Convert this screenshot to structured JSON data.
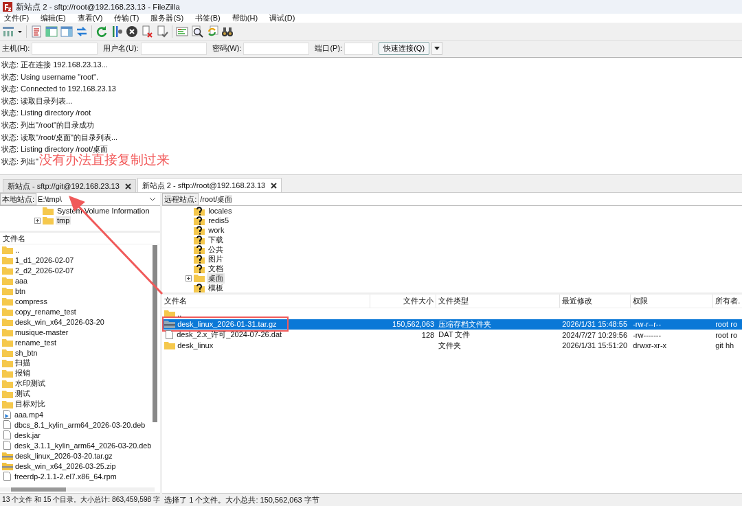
{
  "window": {
    "title": "新站点 2 - sftp://root@192.168.23.13 - FileZilla"
  },
  "menu": [
    "文件(F)",
    "编辑(E)",
    "查看(V)",
    "传输(T)",
    "服务器(S)",
    "书签(B)",
    "帮助(H)",
    "调试(D)"
  ],
  "quickconnect": {
    "fields": [
      {
        "label": "主机(H):"
      },
      {
        "label": "用户名(U):"
      },
      {
        "label": "密码(W):"
      },
      {
        "label": "端口(P):",
        "kind": "short"
      }
    ],
    "button": "快速连接(Q)"
  },
  "log": [
    "状态: 正在连接 192.168.23.13...",
    "状态: Using username \"root\".",
    "状态: Connected to 192.168.23.13",
    "状态: 读取目录列表...",
    "状态: Listing directory /root",
    "状态: 列出\"/root\"的目录成功",
    "状态: 读取\"/root/桌面\"的目录列表...",
    "状态: Listing directory /root/桌面",
    "状态: 列出\""
  ],
  "tabs": [
    {
      "label": "新站点 - sftp://git@192.168.23.13",
      "selected": false
    },
    {
      "label": "新站点 2 - sftp://root@192.168.23.13",
      "selected": true
    }
  ],
  "local": {
    "site_label": "本地站点:",
    "path": "E:\\tmp\\",
    "tree": [
      {
        "name": "System Volume Information",
        "expandable": false,
        "selected": false
      },
      {
        "name": "tmp",
        "expandable": true,
        "selected": true
      }
    ],
    "column": "文件名",
    "files": [
      {
        "name": "..",
        "kind": "folder"
      },
      {
        "name": "1_d1_2026-02-07",
        "kind": "folder"
      },
      {
        "name": "2_d2_2026-02-07",
        "kind": "folder"
      },
      {
        "name": "aaa",
        "kind": "folder"
      },
      {
        "name": "btn",
        "kind": "folder"
      },
      {
        "name": "compress",
        "kind": "folder"
      },
      {
        "name": "copy_rename_test",
        "kind": "folder"
      },
      {
        "name": "desk_win_x64_2026-03-20",
        "kind": "folder"
      },
      {
        "name": "musique-master",
        "kind": "folder"
      },
      {
        "name": "rename_test",
        "kind": "folder"
      },
      {
        "name": "sh_btn",
        "kind": "folder"
      },
      {
        "name": "扫描",
        "kind": "folder"
      },
      {
        "name": "报销",
        "kind": "folder"
      },
      {
        "name": "水印测试",
        "kind": "folder"
      },
      {
        "name": "测试",
        "kind": "folder"
      },
      {
        "name": "目标对比",
        "kind": "folder"
      },
      {
        "name": "aaa.mp4",
        "kind": "video"
      },
      {
        "name": "dbcs_8.1_kylin_arm64_2026-03-20.deb",
        "kind": "file"
      },
      {
        "name": "desk.jar",
        "kind": "file"
      },
      {
        "name": "desk_3.1.1_kylin_arm64_2026-03-20.deb",
        "kind": "file"
      },
      {
        "name": "desk_linux_2026-03-20.tar.gz",
        "kind": "archive"
      },
      {
        "name": "desk_win_x64_2026-03-25.zip",
        "kind": "archive"
      },
      {
        "name": "freerdp-2.1.1-2.el7.x86_64.rpm",
        "kind": "file"
      }
    ],
    "status": "13 个文件 和 15 个目录。大小总计: 863,459,598 字"
  },
  "remote": {
    "site_label": "远程站点:",
    "path": "/root/桌面",
    "tree": [
      {
        "name": "locales",
        "kind": "unknown",
        "expandable": false,
        "selected": false
      },
      {
        "name": "redis5",
        "kind": "unknown",
        "expandable": false,
        "selected": false
      },
      {
        "name": "work",
        "kind": "unknown",
        "expandable": false,
        "selected": false
      },
      {
        "name": "下载",
        "kind": "unknown",
        "expandable": false,
        "selected": false
      },
      {
        "name": "公共",
        "kind": "unknown",
        "expandable": false,
        "selected": false
      },
      {
        "name": "图片",
        "kind": "unknown",
        "expandable": false,
        "selected": false
      },
      {
        "name": "文档",
        "kind": "unknown",
        "expandable": false,
        "selected": false
      },
      {
        "name": "桌面",
        "kind": "folder",
        "expandable": true,
        "selected": true
      },
      {
        "name": "模板",
        "kind": "unknown",
        "expandable": false,
        "selected": false
      }
    ],
    "columns": [
      "文件名",
      "文件大小",
      "文件类型",
      "最近修改",
      "权限",
      "所有者."
    ],
    "files": [
      {
        "name": "..",
        "kind": "folder",
        "selected": false
      },
      {
        "name": "desk_linux_2026-01-31.tar.gz",
        "size": "150,562,063",
        "type": "压缩存档文件夹",
        "modified": "2026/1/31 15:48:55",
        "permissions": "-rw-r--r--",
        "owner": "root ro",
        "kind": "archive",
        "selected": true,
        "framed": true
      },
      {
        "name": "desk_2.x_许可_2024-07-26.dat",
        "size": "128",
        "type": "DAT 文件",
        "modified": "2024/7/27 10:29:56",
        "permissions": "-rw-------",
        "owner": "root ro",
        "kind": "file",
        "selected": false
      },
      {
        "name": "desk_linux",
        "type": "文件夹",
        "modified": "2026/1/31 15:51:20",
        "permissions": "drwxr-xr-x",
        "owner": "git hh",
        "kind": "folder",
        "selected": false
      }
    ],
    "status": "选择了 1 个文件。大小总共: 150,562,063 字节"
  },
  "annotation": {
    "text": "没有办法直接复制过来"
  }
}
